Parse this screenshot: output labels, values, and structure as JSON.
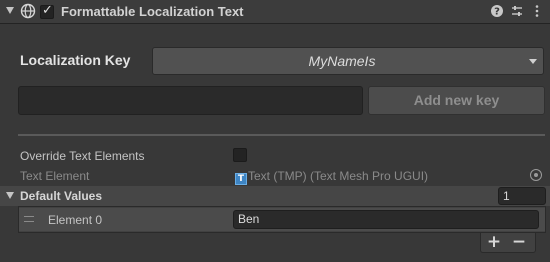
{
  "header": {
    "title": "Formattable Localization Text",
    "enabled": true,
    "icons": [
      "globe-icon",
      "help-icon",
      "preset-icon",
      "more-icon"
    ]
  },
  "localization": {
    "key_label": "Localization Key",
    "selected_key": "MyNameIs",
    "new_key_value": "",
    "add_button_label": "Add new key"
  },
  "fields": {
    "override_label": "Override Text Elements",
    "override_checked": false,
    "text_element_label": "Text Element",
    "text_element_value": "Text (TMP) (Text Mesh Pro UGUI)"
  },
  "default_values": {
    "label": "Default Values",
    "count": "1",
    "elements": [
      {
        "label": "Element 0",
        "value": "Ben"
      }
    ]
  },
  "colors": {
    "background": "#383838",
    "header": "#3c3c3c",
    "tmp_icon": "#3e85c4"
  }
}
